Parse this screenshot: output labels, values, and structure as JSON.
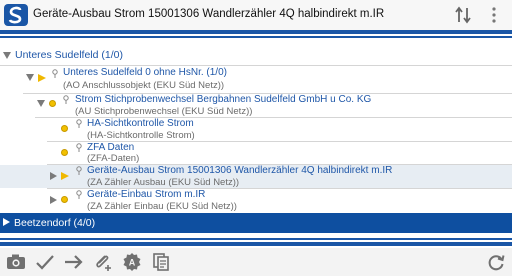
{
  "header": {
    "title": "Geräte-Ausbau Strom 15001306 Wandlerzähler 4Q halbindirekt m.IR",
    "logo_icon": "app-logo-icon",
    "sort_icon": "sort-arrows-icon",
    "menu_icon": "more-vert-icon"
  },
  "tree": {
    "root": {
      "label": "Unteres Sudelfeld (1/0)",
      "expanded": true
    },
    "nodes": [
      {
        "title": "Unteres Sudelfeld     0 ohne HsNr. (1/0)",
        "subtitle": "(AO Anschlussobjekt (EKU Süd Netz))",
        "expanded": true
      },
      {
        "title": "Strom Stichprobenwechsel Bergbahnen Sudelfeld GmbH u Co. KG",
        "subtitle": "(AU Stichprobenwechsel (EKU Süd Netz))",
        "expanded": true
      },
      {
        "title": "HA-Sichtkontrolle Strom",
        "subtitle": "(HA-Sichtkontrolle Strom)"
      },
      {
        "title": "ZFA Daten",
        "subtitle": "(ZFA-Daten)"
      },
      {
        "title": "Geräte-Ausbau Strom 15001306 Wandlerzähler 4Q halbindirekt m.IR",
        "subtitle": "(ZA Zähler Ausbau (EKU Süd Netz))",
        "selected": true
      },
      {
        "title": "Geräte-Einbau Strom m.IR",
        "subtitle": "(ZA Zähler Einbau (EKU Süd Netz))"
      }
    ],
    "footer": {
      "label": "Beetzendorf (4/0)",
      "expanded": false
    }
  },
  "toolbar": {
    "icons": [
      "camera-icon",
      "check-icon",
      "arrow-right-icon",
      "attach-add-icon",
      "auto-badge-icon",
      "copy-icon",
      "refresh-icon"
    ]
  },
  "colors": {
    "accent": "#1a56a6",
    "link": "#1f57a8",
    "highlight": "#e7edf3",
    "status_dot": "#f2c000"
  }
}
